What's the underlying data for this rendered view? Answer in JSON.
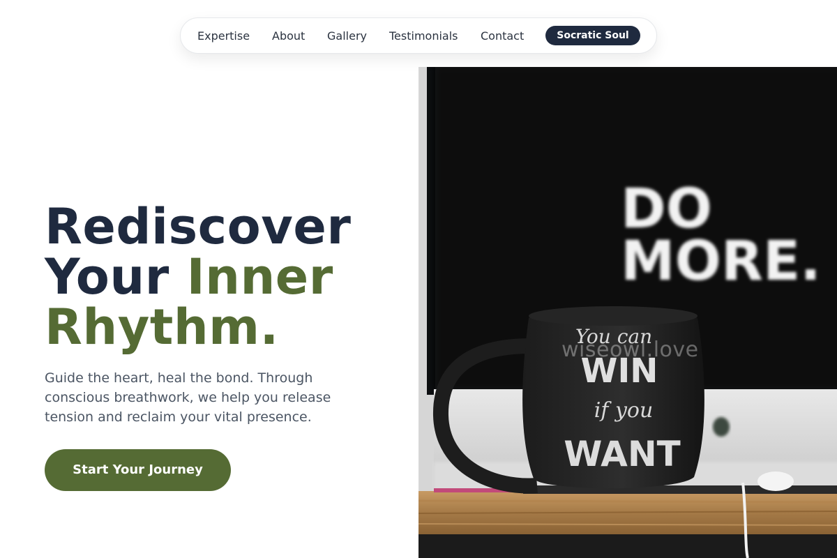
{
  "nav": {
    "links": [
      "Expertise",
      "About",
      "Gallery",
      "Testimonials",
      "Contact"
    ],
    "cta_label": "Socratic Soul"
  },
  "hero": {
    "title_line1": "Rediscover",
    "title_line2_part1": "Your ",
    "title_line2_part2": "Inner",
    "title_line3": "Rhythm.",
    "subtitle": "Guide the heart, heal the bond. Through conscious breathwork, we help you release tension and reclaim your vital presence.",
    "cta_label": "Start Your Journey"
  },
  "image": {
    "screen_text_line1": "DO",
    "screen_text_line2": "MORE.",
    "mug_text": [
      "You can",
      "WIN",
      "if you",
      "WANT"
    ],
    "watermark": "wiseowl.love"
  },
  "colors": {
    "navy": "#1f2a3f",
    "olive": "#556b34",
    "body_text": "#4b5563"
  }
}
